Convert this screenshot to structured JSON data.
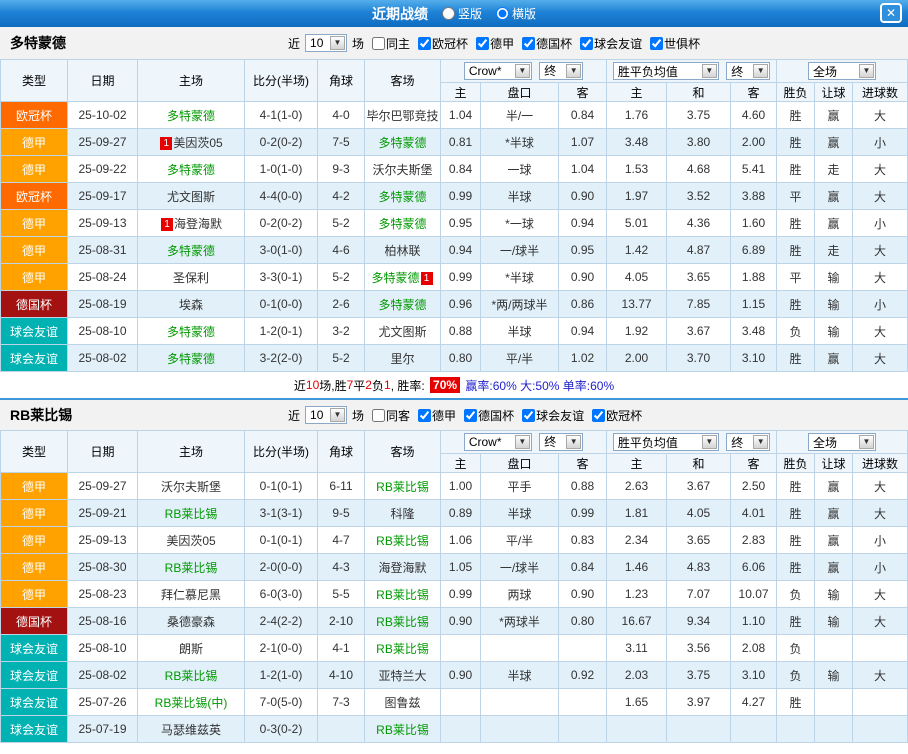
{
  "colors": {
    "titlebar_blue": "#1f82d6",
    "ucl_orange": "#ff6a00",
    "bundesliga_orange": "#ffa200",
    "dfb_dark_red": "#a31111",
    "friendly_teal": "#00b2b2",
    "self_team_green": "#009900",
    "score_red": "#e60000",
    "draw_blue": "#0033cc",
    "lose_green": "#009933",
    "row_alt_blue": "#e2f0fa"
  },
  "topbar": {
    "title": "近期战绩",
    "radios": [
      {
        "label": "竖版",
        "checked": false
      },
      {
        "label": "横版",
        "checked": true
      }
    ],
    "close": "✕"
  },
  "table_controls": {
    "odds_source": "Crow*",
    "final": "终",
    "wdl_mean": "胜平负均值",
    "scope": "全场"
  },
  "table_headers": {
    "type": "类型",
    "date": "日期",
    "home": "主场",
    "score": "比分(半场)",
    "corner": "角球",
    "away": "客场",
    "h_home": "主",
    "handicap": "盘口",
    "h_away": "客",
    "o_home": "主",
    "o_draw": "和",
    "o_away": "客",
    "result": "胜负",
    "let_result": "让球",
    "goals": "进球数"
  },
  "sections": [
    {
      "team": "多特蒙德",
      "filter": {
        "near": "近",
        "count": "10",
        "matches": "场",
        "same": {
          "label": "同主",
          "checked": false
        },
        "leagues": [
          {
            "label": "欧冠杯",
            "checked": true
          },
          {
            "label": "德甲",
            "checked": true
          },
          {
            "label": "德国杯",
            "checked": true
          },
          {
            "label": "球会友谊",
            "checked": true
          },
          {
            "label": "世俱杯",
            "checked": true
          }
        ]
      },
      "rows": [
        {
          "lc": "ucl",
          "league": "欧冠杯",
          "date": "25-10-02",
          "home": "多特蒙德",
          "hs": true,
          "hb": "",
          "score": "4-1(1-0)",
          "corner": "4-0",
          "away": "毕尔巴鄂竞技",
          "as": false,
          "ab": "",
          "h1": "1.04",
          "hc": "半/一",
          "h2": "0.84",
          "o1": "1.76",
          "o2": "3.75",
          "o3": "4.60",
          "res": "胜",
          "let": "赢",
          "gl": "大"
        },
        {
          "lc": "bl",
          "league": "德甲",
          "date": "25-09-27",
          "home": "美因茨05",
          "hs": false,
          "hb": "1",
          "score": "0-2(0-2)",
          "corner": "7-5",
          "away": "多特蒙德",
          "as": true,
          "ab": "",
          "h1": "0.81",
          "hc": "*半球",
          "h2": "1.07",
          "o1": "3.48",
          "o2": "3.80",
          "o3": "2.00",
          "res": "胜",
          "let": "赢",
          "gl": "小"
        },
        {
          "lc": "bl",
          "league": "德甲",
          "date": "25-09-22",
          "home": "多特蒙德",
          "hs": true,
          "hb": "",
          "score": "1-0(1-0)",
          "corner": "9-3",
          "away": "沃尔夫斯堡",
          "as": false,
          "ab": "",
          "h1": "0.84",
          "hc": "一球",
          "h2": "1.04",
          "o1": "1.53",
          "o2": "4.68",
          "o3": "5.41",
          "res": "胜",
          "let": "走",
          "gl": "大"
        },
        {
          "lc": "ucl",
          "league": "欧冠杯",
          "date": "25-09-17",
          "home": "尤文图斯",
          "hs": false,
          "hb": "",
          "score": "4-4(0-0)",
          "corner": "4-2",
          "away": "多特蒙德",
          "as": true,
          "ab": "",
          "h1": "0.99",
          "hc": "半球",
          "h2": "0.90",
          "o1": "1.97",
          "o2": "3.52",
          "o3": "3.88",
          "res": "平",
          "let": "赢",
          "gl": "大"
        },
        {
          "lc": "bl",
          "league": "德甲",
          "date": "25-09-13",
          "home": "海登海默",
          "hs": false,
          "hb": "1",
          "score": "0-2(0-2)",
          "corner": "5-2",
          "away": "多特蒙德",
          "as": true,
          "ab": "",
          "h1": "0.95",
          "hc": "*一球",
          "h2": "0.94",
          "o1": "5.01",
          "o2": "4.36",
          "o3": "1.60",
          "res": "胜",
          "let": "赢",
          "gl": "小"
        },
        {
          "lc": "bl",
          "league": "德甲",
          "date": "25-08-31",
          "home": "多特蒙德",
          "hs": true,
          "hb": "",
          "score": "3-0(1-0)",
          "corner": "4-6",
          "away": "柏林联",
          "as": false,
          "ab": "",
          "h1": "0.94",
          "hc": "一/球半",
          "h2": "0.95",
          "o1": "1.42",
          "o2": "4.87",
          "o3": "6.89",
          "res": "胜",
          "let": "走",
          "gl": "大"
        },
        {
          "lc": "bl",
          "league": "德甲",
          "date": "25-08-24",
          "home": "圣保利",
          "hs": false,
          "hb": "",
          "score": "3-3(0-1)",
          "corner": "5-2",
          "away": "多特蒙德",
          "as": true,
          "ab": "1",
          "h1": "0.99",
          "hc": "*半球",
          "h2": "0.90",
          "o1": "4.05",
          "o2": "3.65",
          "o3": "1.88",
          "res": "平",
          "let": "输",
          "gl": "大"
        },
        {
          "lc": "dfb",
          "league": "德国杯",
          "date": "25-08-19",
          "home": "埃森",
          "hs": false,
          "hb": "",
          "score": "0-1(0-0)",
          "corner": "2-6",
          "away": "多特蒙德",
          "as": true,
          "ab": "",
          "h1": "0.96",
          "hc": "*两/两球半",
          "h2": "0.86",
          "o1": "13.77",
          "o2": "7.85",
          "o3": "1.15",
          "res": "胜",
          "let": "输",
          "gl": "小"
        },
        {
          "lc": "fr",
          "league": "球会友谊",
          "date": "25-08-10",
          "home": "多特蒙德",
          "hs": true,
          "hb": "",
          "score": "1-2(0-1)",
          "corner": "3-2",
          "away": "尤文图斯",
          "as": false,
          "ab": "",
          "h1": "0.88",
          "hc": "半球",
          "h2": "0.94",
          "o1": "1.92",
          "o2": "3.67",
          "o3": "3.48",
          "res": "负",
          "let": "输",
          "gl": "大"
        },
        {
          "lc": "fr",
          "league": "球会友谊",
          "date": "25-08-02",
          "home": "多特蒙德",
          "hs": true,
          "hb": "",
          "score": "3-2(2-0)",
          "corner": "5-2",
          "away": "里尔",
          "as": false,
          "ab": "",
          "h1": "0.80",
          "hc": "平/半",
          "h2": "1.02",
          "o1": "2.00",
          "o2": "3.70",
          "o3": "3.10",
          "res": "胜",
          "let": "赢",
          "gl": "大"
        }
      ],
      "summary": [
        {
          "t": "近",
          "c": "k"
        },
        {
          "t": "10",
          "c": "r"
        },
        {
          "t": "场,胜",
          "c": "k"
        },
        {
          "t": "7",
          "c": "r"
        },
        {
          "t": "平",
          "c": "k"
        },
        {
          "t": "2",
          "c": "r"
        },
        {
          "t": "负",
          "c": "k"
        },
        {
          "t": "1",
          "c": "r"
        },
        {
          "t": ", 胜率: ",
          "c": "k"
        },
        {
          "t": "70%",
          "c": "badge"
        },
        {
          "t": " 赢率:60%",
          "c": "b"
        },
        {
          "t": " 大:50%",
          "c": "b"
        },
        {
          "t": " 单率:60%",
          "c": "b"
        }
      ]
    },
    {
      "team": "RB莱比锡",
      "filter": {
        "near": "近",
        "count": "10",
        "matches": "场",
        "same": {
          "label": "同客",
          "checked": false
        },
        "leagues": [
          {
            "label": "德甲",
            "checked": true
          },
          {
            "label": "德国杯",
            "checked": true
          },
          {
            "label": "球会友谊",
            "checked": true
          },
          {
            "label": "欧冠杯",
            "checked": true
          }
        ]
      },
      "rows": [
        {
          "lc": "bl",
          "league": "德甲",
          "date": "25-09-27",
          "home": "沃尔夫斯堡",
          "hs": false,
          "hb": "",
          "score": "0-1(0-1)",
          "corner": "6-11",
          "away": "RB莱比锡",
          "as": true,
          "ab": "",
          "h1": "1.00",
          "hc": "平手",
          "h2": "0.88",
          "o1": "2.63",
          "o2": "3.67",
          "o3": "2.50",
          "res": "胜",
          "let": "赢",
          "gl": "大"
        },
        {
          "lc": "bl",
          "league": "德甲",
          "date": "25-09-21",
          "home": "RB莱比锡",
          "hs": true,
          "hb": "",
          "score": "3-1(3-1)",
          "corner": "9-5",
          "away": "科隆",
          "as": false,
          "ab": "",
          "h1": "0.89",
          "hc": "半球",
          "h2": "0.99",
          "o1": "1.81",
          "o2": "4.05",
          "o3": "4.01",
          "res": "胜",
          "let": "赢",
          "gl": "大"
        },
        {
          "lc": "bl",
          "league": "德甲",
          "date": "25-09-13",
          "home": "美因茨05",
          "hs": false,
          "hb": "",
          "score": "0-1(0-1)",
          "corner": "4-7",
          "away": "RB莱比锡",
          "as": true,
          "ab": "",
          "h1": "1.06",
          "hc": "平/半",
          "h2": "0.83",
          "o1": "2.34",
          "o2": "3.65",
          "o3": "2.83",
          "res": "胜",
          "let": "赢",
          "gl": "小"
        },
        {
          "lc": "bl",
          "league": "德甲",
          "date": "25-08-30",
          "home": "RB莱比锡",
          "hs": true,
          "hb": "",
          "score": "2-0(0-0)",
          "corner": "4-3",
          "away": "海登海默",
          "as": false,
          "ab": "",
          "h1": "1.05",
          "hc": "一/球半",
          "h2": "0.84",
          "o1": "1.46",
          "o2": "4.83",
          "o3": "6.06",
          "res": "胜",
          "let": "赢",
          "gl": "小"
        },
        {
          "lc": "bl",
          "league": "德甲",
          "date": "25-08-23",
          "home": "拜仁慕尼黑",
          "hs": false,
          "hb": "",
          "score": "6-0(3-0)",
          "corner": "5-5",
          "away": "RB莱比锡",
          "as": true,
          "ab": "",
          "h1": "0.99",
          "hc": "两球",
          "h2": "0.90",
          "o1": "1.23",
          "o2": "7.07",
          "o3": "10.07",
          "res": "负",
          "let": "输",
          "gl": "大"
        },
        {
          "lc": "dfb",
          "league": "德国杯",
          "date": "25-08-16",
          "home": "桑德豪森",
          "hs": false,
          "hb": "",
          "score": "2-4(2-2)",
          "corner": "2-10",
          "away": "RB莱比锡",
          "as": true,
          "ab": "",
          "h1": "0.90",
          "hc": "*两球半",
          "h2": "0.80",
          "o1": "16.67",
          "o2": "9.34",
          "o3": "1.10",
          "res": "胜",
          "let": "输",
          "gl": "大"
        },
        {
          "lc": "fr",
          "league": "球会友谊",
          "date": "25-08-10",
          "home": "朗斯",
          "hs": false,
          "hb": "",
          "score": "2-1(0-0)",
          "corner": "4-1",
          "away": "RB莱比锡",
          "as": true,
          "ab": "",
          "h1": "",
          "hc": "",
          "h2": "",
          "o1": "3.11",
          "o2": "3.56",
          "o3": "2.08",
          "res": "负",
          "let": "",
          "gl": ""
        },
        {
          "lc": "fr",
          "league": "球会友谊",
          "date": "25-08-02",
          "home": "RB莱比锡",
          "hs": true,
          "hb": "",
          "score": "1-2(1-0)",
          "corner": "4-10",
          "away": "亚特兰大",
          "as": false,
          "ab": "",
          "h1": "0.90",
          "hc": "半球",
          "h2": "0.92",
          "o1": "2.03",
          "o2": "3.75",
          "o3": "3.10",
          "res": "负",
          "let": "输",
          "gl": "大"
        },
        {
          "lc": "fr",
          "league": "球会友谊",
          "date": "25-07-26",
          "home": "RB莱比锡(中)",
          "hs": true,
          "hb": "",
          "score": "7-0(5-0)",
          "corner": "7-3",
          "away": "图鲁兹",
          "as": false,
          "ab": "",
          "h1": "",
          "hc": "",
          "h2": "",
          "o1": "1.65",
          "o2": "3.97",
          "o3": "4.27",
          "res": "胜",
          "let": "",
          "gl": ""
        },
        {
          "lc": "fr",
          "league": "球会友谊",
          "date": "25-07-19",
          "home": "马瑟维兹英",
          "hs": false,
          "hb": "",
          "score": "0-3(0-2)",
          "corner": "",
          "away": "RB莱比锡",
          "as": true,
          "ab": "",
          "h1": "",
          "hc": "",
          "h2": "",
          "o1": "",
          "o2": "",
          "o3": "",
          "res": "",
          "let": "",
          "gl": ""
        }
      ],
      "summary": null
    }
  ]
}
